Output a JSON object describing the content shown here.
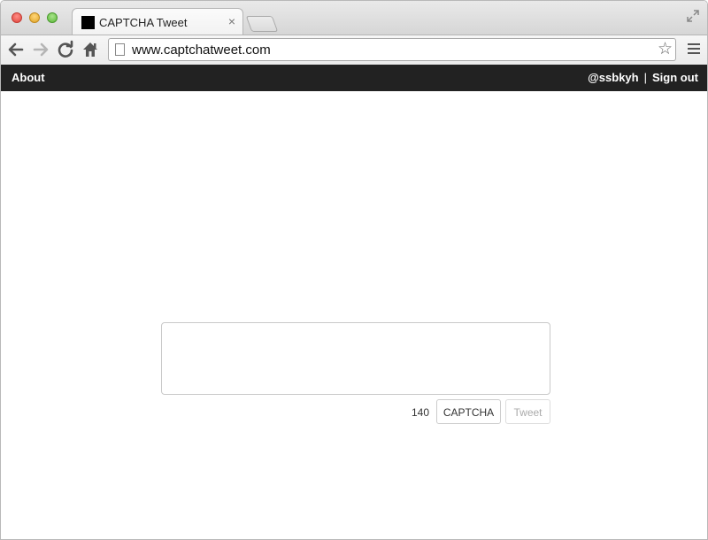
{
  "browser": {
    "tab_title": "CAPTCHA Tweet",
    "tab_close": "×",
    "url": "www.captchatweet.com",
    "icons": {
      "back": "arrow-left",
      "forward": "arrow-right",
      "reload": "reload",
      "home": "home",
      "star": "star",
      "menu": "hamburger",
      "fullscreen": "expand"
    }
  },
  "navbar": {
    "about": "About",
    "username": "@ssbkyh",
    "separator": "|",
    "sign_out": "Sign out",
    "background": "#222222"
  },
  "composer": {
    "text": "",
    "char_count": "140",
    "captcha_label": "CAPTCHA",
    "tweet_label": "Tweet"
  }
}
